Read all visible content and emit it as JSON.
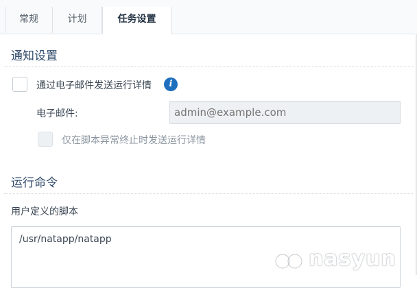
{
  "tabs": [
    {
      "label": "常规"
    },
    {
      "label": "计划"
    },
    {
      "label": "任务设置"
    }
  ],
  "active_tab": "任务设置",
  "notification": {
    "title": "通知设置",
    "email_checkbox_label": "通过电子邮件发送运行详情",
    "email_checked": false,
    "email_label": "电子邮件:",
    "email_placeholder": "admin@example.com",
    "abnormal_only_label": "仅在脚本异常终止时发送运行详情",
    "abnormal_only_checked": false,
    "abnormal_only_disabled": true
  },
  "run_command": {
    "title": "运行命令",
    "script_label": "用户定义的脚本",
    "script_value": "/usr/natapp/natapp"
  },
  "watermark": {
    "text": "nasyun",
    "icon": "nasyun-logo-icon"
  },
  "colors": {
    "accent": "#1f6fbf",
    "section_title": "#2f4a6a"
  }
}
